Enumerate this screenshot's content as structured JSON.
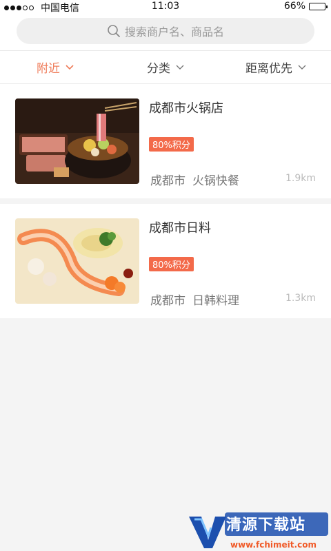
{
  "status_bar": {
    "carrier": "中国电信",
    "time": "11:03",
    "battery": "66%",
    "battery_level": 0.66,
    "signal_bars_filled": 3,
    "signal_bars_total": 5
  },
  "search": {
    "placeholder": "搜索商户名、商品名"
  },
  "filters": [
    {
      "label": "附近",
      "active": true
    },
    {
      "label": "分类",
      "active": false
    },
    {
      "label": "距离优先",
      "active": false
    }
  ],
  "colors": {
    "accent": "#ef7c5a",
    "tag": "#f36a4a"
  },
  "stores": [
    {
      "name": "成都市火锅店",
      "tag": "80%积分",
      "city": "成都市",
      "category": "火锅快餐",
      "distance": "1.9km",
      "image": "hotpot-photo"
    },
    {
      "name": "成都市日料",
      "tag": "80%积分",
      "city": "成都市",
      "category": "日韩料理",
      "distance": "1.3km",
      "image": "sushi-photo"
    }
  ],
  "watermark": {
    "title": "清源下载站",
    "url": "www.fchimeit.com"
  }
}
